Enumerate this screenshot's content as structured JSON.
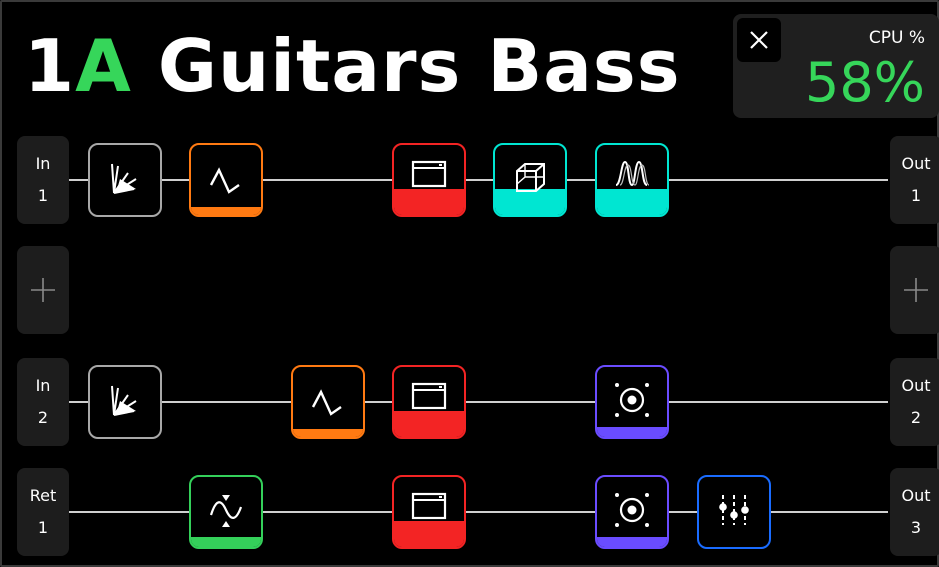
{
  "preset": {
    "number": "1",
    "letter": "A",
    "name": " Guitars Bass"
  },
  "cpu": {
    "label": "CPU %",
    "value": "58%"
  },
  "colors": {
    "accent": "#36d65a",
    "amp": "#f32424",
    "delay": "#00e6d2",
    "reverb": "#00e6d2",
    "eq": "#ff7a12",
    "cab": "#6a4cff",
    "filter": "#34d05a",
    "mixer": "#1a6cff"
  },
  "rows": [
    {
      "input": {
        "label": "In",
        "num": "1"
      },
      "output": {
        "label": "Out",
        "num": "1"
      },
      "blocks": [
        "wah-icon",
        "eq-filter-icon",
        "amp-icon",
        "delay-cube-icon",
        "reverb-wave-icon"
      ]
    },
    {
      "input": {
        "label": "+"
      },
      "output": {
        "label": "+"
      },
      "blocks": []
    },
    {
      "input": {
        "label": "In",
        "num": "2"
      },
      "output": {
        "label": "Out",
        "num": "2"
      },
      "blocks": [
        "wah-icon",
        "eq-filter-icon",
        "amp-icon",
        "cab-speaker-icon"
      ]
    },
    {
      "input": {
        "label": "Ret",
        "num": "1"
      },
      "output": {
        "label": "Out",
        "num": "3"
      },
      "blocks": [
        "filter-sine-icon",
        "amp-icon",
        "cab-speaker-icon",
        "mixer-sliders-icon"
      ]
    }
  ]
}
